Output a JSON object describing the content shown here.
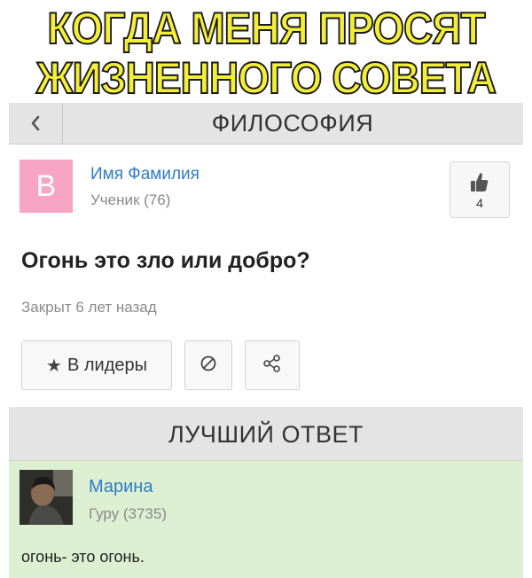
{
  "caption": {
    "line1": "КОГДА МЕНЯ ПРОСЯТ",
    "line2": "ЖИЗНЕННОГО СОВЕТА",
    "fill_color": "#f2ee3a"
  },
  "header": {
    "back_icon": "chevron-left-icon",
    "category": "ФИЛОСОФИЯ"
  },
  "author": {
    "avatar_letter": "В",
    "avatar_color": "#f6a6c2",
    "name": "Имя Фамилия",
    "rank": "Ученик (76)"
  },
  "like": {
    "icon": "thumbs-up-icon",
    "count": "4"
  },
  "question": {
    "title": "Огонь это зло или добро?",
    "status": "Закрыт 6 лет назад"
  },
  "actions": {
    "leaders_icon": "star-icon",
    "leaders_label": "В лидеры",
    "block_icon": "block-icon",
    "share_icon": "share-icon"
  },
  "best_answer": {
    "header": "ЛУЧШИЙ ОТВЕТ",
    "name": "Марина",
    "rank": "Гуру (3735)",
    "text": "огонь- это огонь.",
    "bg_color": "#dcefd2"
  },
  "colors": {
    "link": "#2d7dc4",
    "muted": "#8a8a8a",
    "bar": "#e4e4e4"
  }
}
